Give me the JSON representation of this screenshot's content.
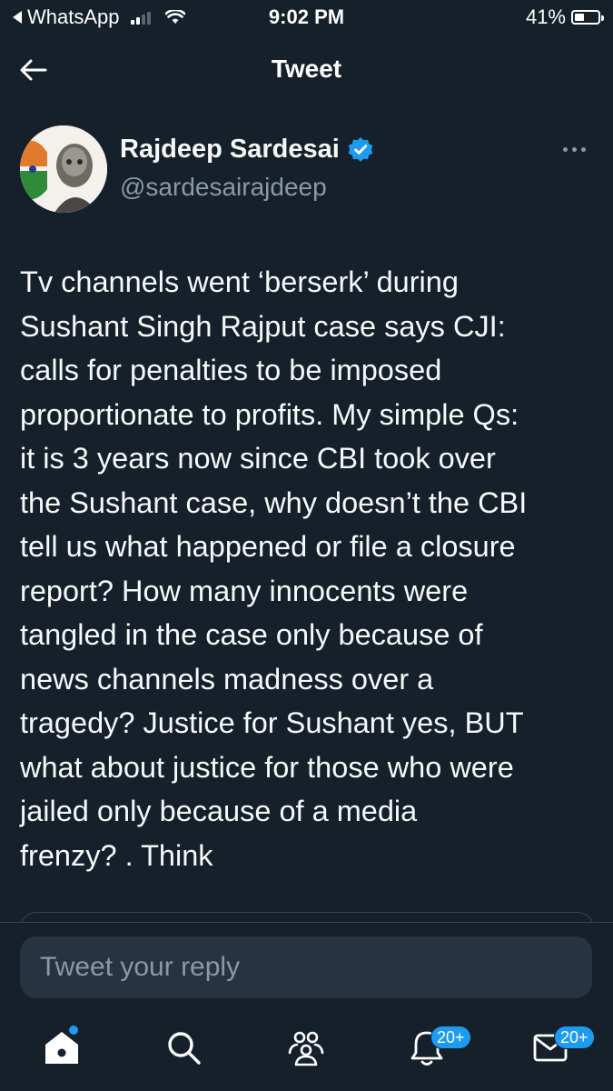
{
  "status_bar": {
    "back_app": "WhatsApp",
    "time": "9:02 PM",
    "battery": "41%",
    "battery_level": 0.41,
    "signal_bars": 2
  },
  "header": {
    "title": "Tweet",
    "back_icon": "arrow-left-icon"
  },
  "tweet": {
    "author_name": "Rajdeep Sardesai",
    "author_handle": "@sardesairajdeep",
    "verified": true,
    "text": "Tv channels went ‘berserk’ during\nSushant Singh Rajput case says CJI:\ncalls for penalties to be imposed\nproportionate to profits. My simple Qs:\nit is 3 years now since CBI took over\nthe Sushant case, why doesn’t the CBI\ntell us what happened or file a closure\nreport? How many innocents were\ntangled in the case only because of\nnews channels madness over a\ntragedy? Justice for Sushant yes, BUT\nwhat about justice for those who were\njailed only because of a media\nfrenzy?  . Think"
  },
  "reply": {
    "placeholder": "Tweet your reply",
    "value": ""
  },
  "bottom_nav": {
    "items": [
      {
        "icon": "home-icon",
        "badge": ""
      },
      {
        "icon": "search-icon",
        "badge": ""
      },
      {
        "icon": "communities-icon",
        "badge": ""
      },
      {
        "icon": "notifications-icon",
        "badge": "20+"
      },
      {
        "icon": "messages-icon",
        "badge": "20+"
      }
    ]
  },
  "colors": {
    "background": "#15202b",
    "accent": "#1d9bf0",
    "secondary_text": "#8b98a5"
  }
}
